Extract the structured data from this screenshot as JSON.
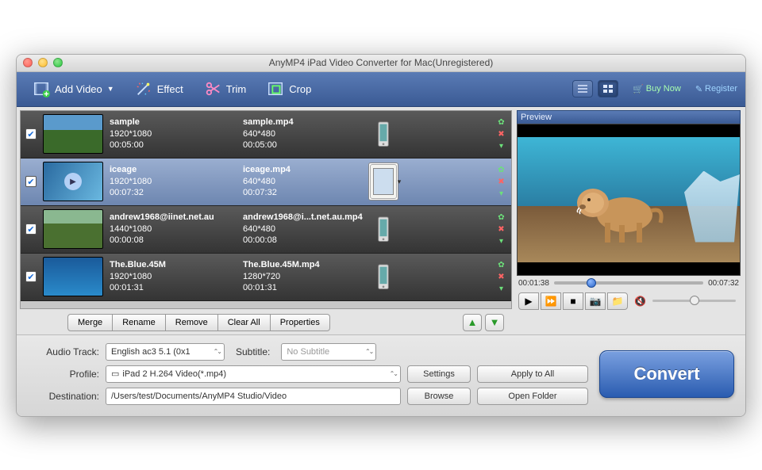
{
  "window_title": "AnyMP4 iPad Video Converter for Mac(Unregistered)",
  "toolbar": {
    "add_video": "Add Video",
    "effect": "Effect",
    "trim": "Trim",
    "crop": "Crop",
    "buy_now": "Buy Now",
    "register": "Register"
  },
  "files": [
    {
      "name": "sample",
      "res": "1920*1080",
      "dur": "00:05:00",
      "out": "sample.mp4",
      "outres": "640*480",
      "outdur": "00:05:00",
      "selected": false,
      "device": "phone"
    },
    {
      "name": "iceage",
      "res": "1920*1080",
      "dur": "00:07:32",
      "out": "iceage.mp4",
      "outres": "640*480",
      "outdur": "00:07:32",
      "selected": true,
      "device": "ipad"
    },
    {
      "name": "andrew1968@iinet.net.au",
      "res": "1440*1080",
      "dur": "00:00:08",
      "out": "andrew1968@i...t.net.au.mp4",
      "outres": "640*480",
      "outdur": "00:00:08",
      "selected": false,
      "device": "phone"
    },
    {
      "name": "The.Blue.45M",
      "res": "1920*1080",
      "dur": "00:01:31",
      "out": "The.Blue.45M.mp4",
      "outres": "1280*720",
      "outdur": "00:01:31",
      "selected": false,
      "device": "phone"
    }
  ],
  "table_actions": {
    "merge": "Merge",
    "rename": "Rename",
    "remove": "Remove",
    "clear": "Clear All",
    "props": "Properties"
  },
  "preview": {
    "label": "Preview",
    "cur": "00:01:38",
    "total": "00:07:32"
  },
  "form": {
    "audio_label": "Audio Track:",
    "audio_value": "English ac3 5.1 (0x1",
    "subtitle_label": "Subtitle:",
    "subtitle_value": "No Subtitle",
    "profile_label": "Profile:",
    "profile_value": "iPad 2 H.264 Video(*.mp4)",
    "dest_label": "Destination:",
    "dest_value": "/Users/test/Documents/AnyMP4 Studio/Video",
    "settings": "Settings",
    "apply": "Apply to All",
    "browse": "Browse",
    "open": "Open Folder"
  },
  "convert": "Convert"
}
